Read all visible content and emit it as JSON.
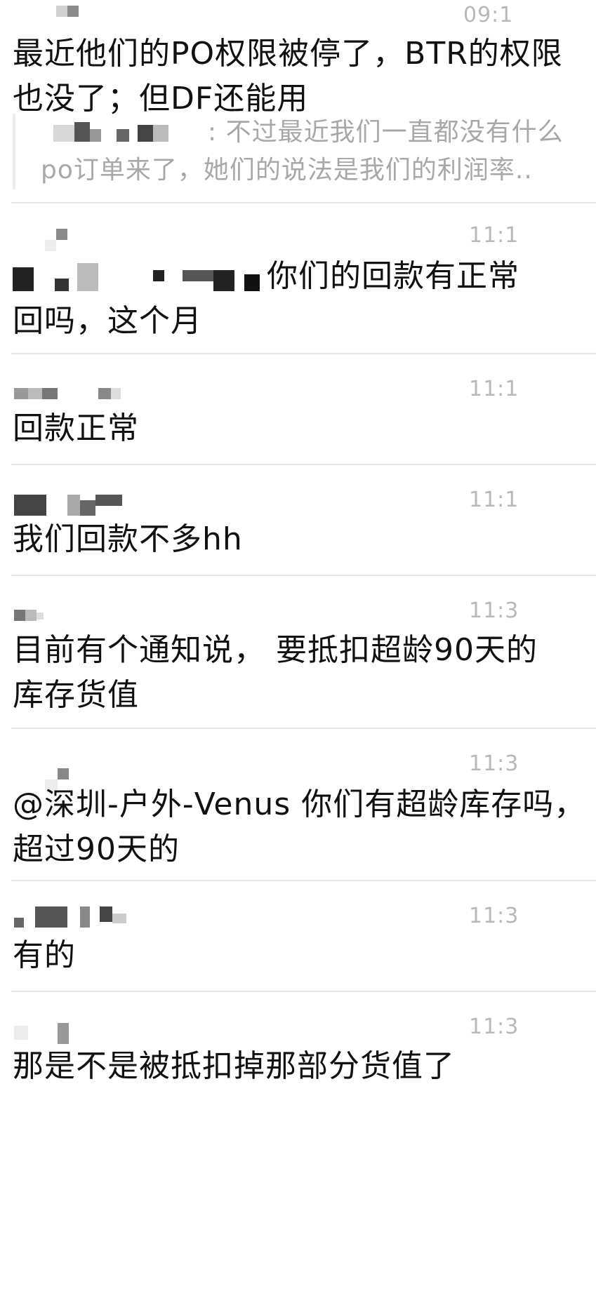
{
  "messages": [
    {
      "time": "09:1",
      "lines": [
        "最近他们的PO权限被停了，BTR的权限",
        "也没了；但DF还能用"
      ],
      "quote": {
        "prefix": ":",
        "lines": [
          "不过最近我们一直都没有什么",
          "po订单来了，她们的说法是我们的利润率.."
        ]
      }
    },
    {
      "time": "11:1",
      "lines": [
        "你们的回款有正常",
        "回吗，这个月"
      ]
    },
    {
      "time": "11:1",
      "lines": [
        "回款正常"
      ]
    },
    {
      "time": "11:1",
      "lines": [
        "我们回款不多hh"
      ]
    },
    {
      "time": "11:3",
      "lines": [
        "目前有个通知说， 要抵扣超龄90天的",
        "库存货值"
      ]
    },
    {
      "time": "11:3",
      "lines": [
        "@深圳-户外-Venus 你们有超龄库存吗，",
        "超过90天的"
      ]
    },
    {
      "time": "11:3",
      "lines": [
        "有的"
      ]
    },
    {
      "time": "11:3",
      "lines": [
        "那是不是被抵扣掉那部分货值了"
      ]
    }
  ],
  "colors": {
    "text": "#111111",
    "time": "#b8b8b8",
    "quote": "#a8a8a8",
    "divider": "#e6e6e6",
    "background": "#ffffff"
  }
}
